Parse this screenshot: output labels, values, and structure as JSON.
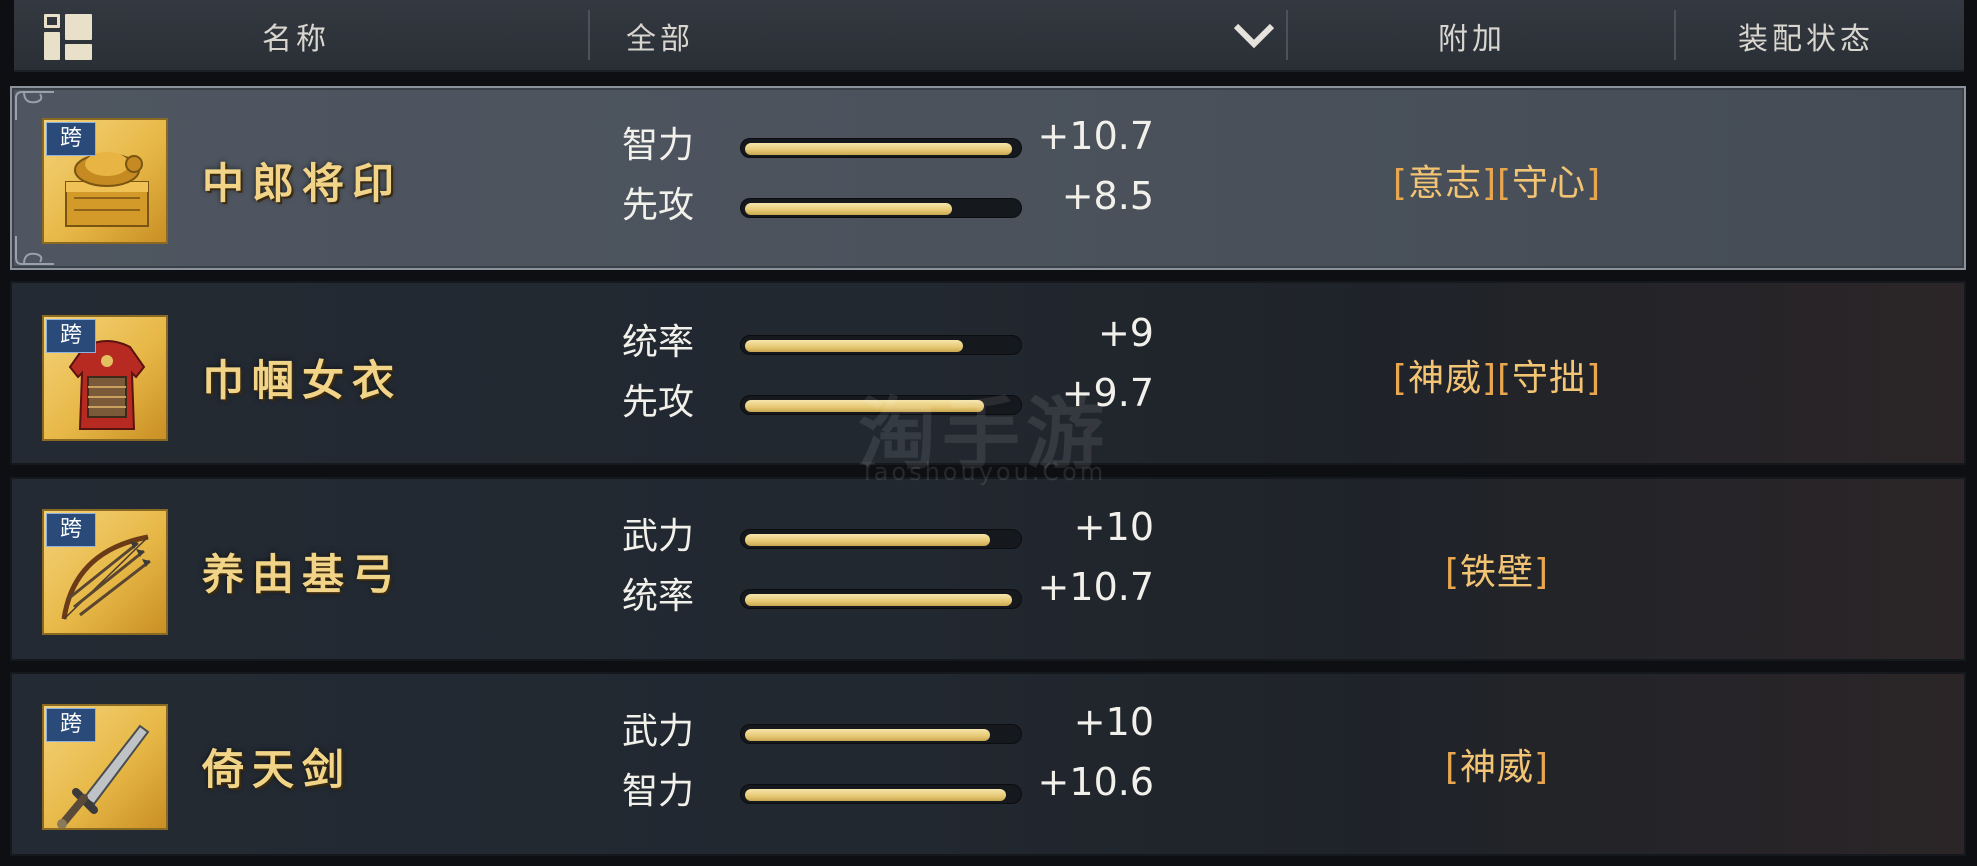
{
  "header": {
    "name_col": "名称",
    "filter_value": "全部",
    "extra_col": "附加",
    "equip_col": "装配状态"
  },
  "items": [
    {
      "tag": "跨",
      "name": "中郎将印",
      "icon": "golden-seal-icon",
      "stats": [
        {
          "label": "智力",
          "value": "+10.7",
          "fill": 0.98
        },
        {
          "label": "先攻",
          "value": "+8.5",
          "fill": 0.76
        }
      ],
      "extras": [
        "意志",
        "守心"
      ]
    },
    {
      "tag": "跨",
      "name": "巾帼女衣",
      "icon": "armor-robe-icon",
      "stats": [
        {
          "label": "统率",
          "value": "+9",
          "fill": 0.8
        },
        {
          "label": "先攻",
          "value": "+9.7",
          "fill": 0.88
        }
      ],
      "extras": [
        "神威",
        "守拙"
      ]
    },
    {
      "tag": "跨",
      "name": "养由基弓",
      "icon": "bow-arrows-icon",
      "stats": [
        {
          "label": "武力",
          "value": "+10",
          "fill": 0.9
        },
        {
          "label": "统率",
          "value": "+10.7",
          "fill": 0.98
        }
      ],
      "extras": [
        "铁壁"
      ]
    },
    {
      "tag": "跨",
      "name": "倚天剑",
      "icon": "sword-icon",
      "stats": [
        {
          "label": "武力",
          "value": "+10",
          "fill": 0.9
        },
        {
          "label": "智力",
          "value": "+10.6",
          "fill": 0.96
        }
      ],
      "extras": [
        "神威"
      ]
    }
  ],
  "watermark": {
    "main": "淘手游",
    "sub": "Taoshouyou.Com"
  },
  "colors": {
    "accent_gold": "#f1d488",
    "bar_gold": "#e6c874",
    "extra_orange": "#e8a64e",
    "tag_blue": "#2a4a7a"
  }
}
